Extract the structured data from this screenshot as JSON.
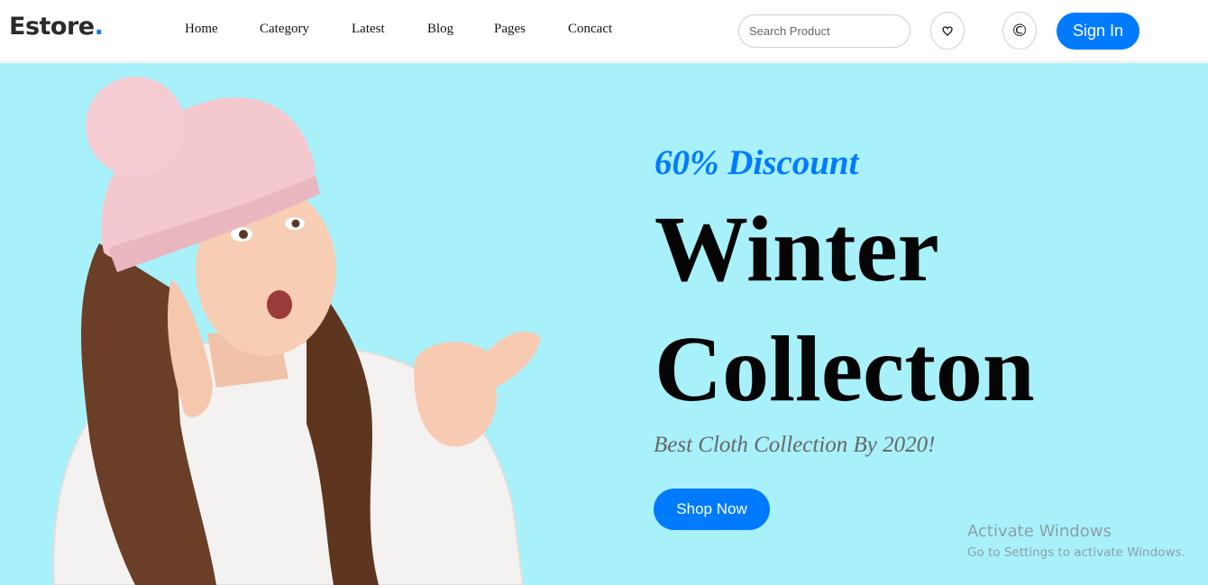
{
  "header": {
    "logo_text": "Estore",
    "logo_dot": ".",
    "nav": [
      {
        "label": "Home"
      },
      {
        "label": "Category"
      },
      {
        "label": "Latest"
      },
      {
        "label": "Blog"
      },
      {
        "label": "Pages"
      },
      {
        "label": "Concact"
      }
    ],
    "search_placeholder": "Search Product",
    "wishlist_icon": "heart-icon",
    "cart_icon": "copyright-icon",
    "cart_glyph": "©",
    "signin_label": "Sign In"
  },
  "hero": {
    "discount": "60% Discount",
    "title_line1": "Winter",
    "title_line2": "Collecton",
    "subtitle": "Best Cloth Collection By 2020!",
    "cta_label": "Shop Now",
    "image_subject": "girl-in-winter-hat"
  },
  "watermark": {
    "title": "Activate Windows",
    "subtitle": "Go to Settings to activate Windows."
  },
  "colors": {
    "accent": "#007bff",
    "hero_bg": "#a8f1fa",
    "title": "#050505",
    "subtitle": "#666666"
  }
}
